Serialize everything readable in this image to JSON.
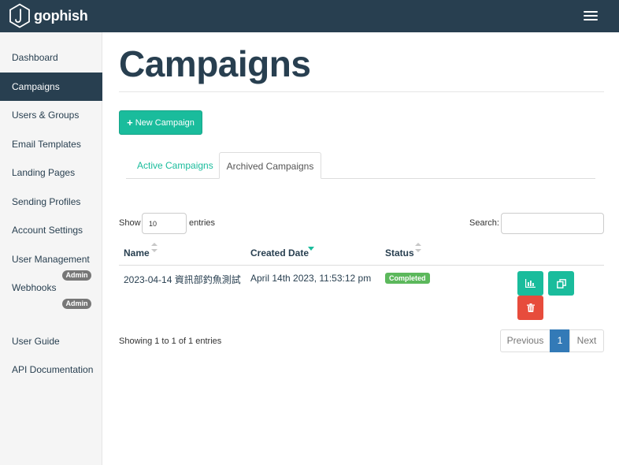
{
  "brand": {
    "name": "gophish"
  },
  "sidebar": {
    "items": [
      {
        "label": "Dashboard"
      },
      {
        "label": "Campaigns"
      },
      {
        "label": "Users & Groups"
      },
      {
        "label": "Email Templates"
      },
      {
        "label": "Landing Pages"
      },
      {
        "label": "Sending Profiles"
      },
      {
        "label": "Account Settings"
      },
      {
        "label": "User Management"
      },
      {
        "label": "Webhooks"
      },
      {
        "label": "User Guide"
      },
      {
        "label": "API Documentation"
      }
    ],
    "badges": {
      "user_management": "Admin",
      "webhooks": "Admin"
    }
  },
  "main": {
    "title": "Campaigns",
    "new_button": {
      "plus": "+",
      "label": "New Campaign"
    },
    "tabs": [
      {
        "label": "Active Campaigns"
      },
      {
        "label": "Archived Campaigns"
      }
    ],
    "active_tab": "Archived Campaigns",
    "table_controls": {
      "show_label": "Show",
      "entries_value": "10",
      "entries_label": "entries",
      "search_label": "Search:",
      "search_value": ""
    },
    "table": {
      "columns": [
        {
          "label": "Name"
        },
        {
          "label": "Created Date"
        },
        {
          "label": "Status"
        }
      ],
      "rows": [
        {
          "name": "2023-04-14 資訊部釣魚測試",
          "created": "April 14th 2023, 11:53:12 pm",
          "status": "Completed"
        }
      ]
    },
    "info": "Showing 1 to 1 of 1 entries",
    "pagination": {
      "previous": "Previous",
      "current": "1",
      "next": "Next"
    }
  },
  "colors": {
    "navbar": "#283f50",
    "accent": "#1abc9c",
    "danger": "#e74c3c",
    "status_completed": "#5cb85c",
    "pagination_active": "#337ab7"
  },
  "icons": {
    "logo": "gophish-hook-hexagon-icon",
    "menu": "hamburger-menu-icon",
    "results": "bar-chart-icon",
    "copy": "copy-icon",
    "delete": "trash-icon",
    "sort_both": "sort-both-icon",
    "sort_desc": "sort-desc-icon"
  }
}
